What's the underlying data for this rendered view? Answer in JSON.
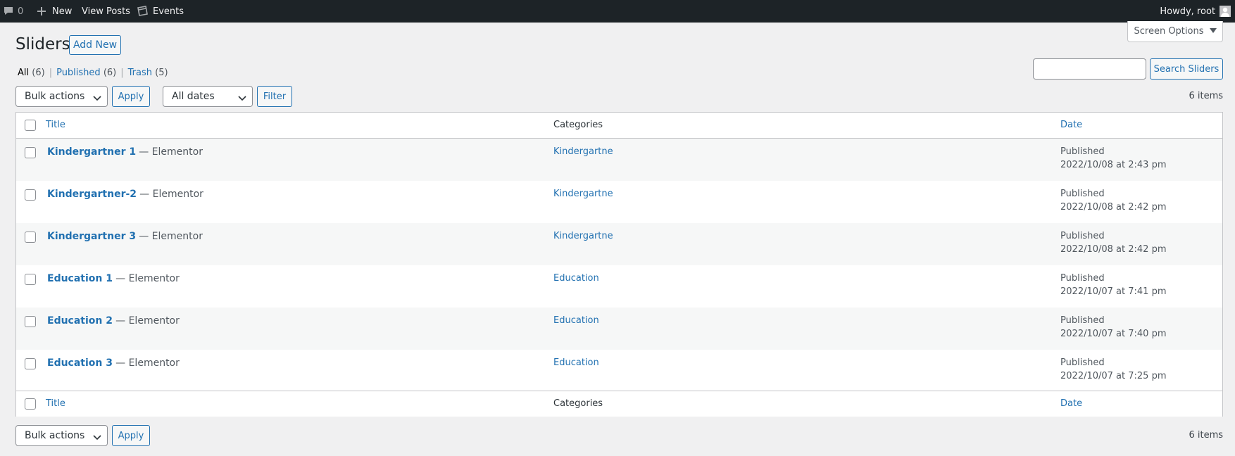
{
  "adminbar": {
    "comments_count": "0",
    "new_label": "New",
    "view_posts_label": "View Posts",
    "events_label": "Events",
    "howdy_label": "Howdy, root"
  },
  "screen_options": {
    "label": "Screen Options"
  },
  "page": {
    "title": "Sliders",
    "add_new_label": "Add New"
  },
  "views": [
    {
      "label": "All",
      "count": "(6)",
      "current": true
    },
    {
      "label": "Published",
      "count": "(6)",
      "current": false
    },
    {
      "label": "Trash",
      "count": "(5)",
      "current": false
    }
  ],
  "search": {
    "value": "",
    "button_label": "Search Sliders"
  },
  "tablenav_top": {
    "bulk_actions": "Bulk actions",
    "apply_label": "Apply",
    "dates_filter": "All dates",
    "filter_label": "Filter",
    "items_count": "6 items"
  },
  "tablenav_bottom": {
    "bulk_actions": "Bulk actions",
    "apply_label": "Apply",
    "items_count": "6 items"
  },
  "table": {
    "columns": {
      "title": "Title",
      "categories": "Categories",
      "date": "Date"
    },
    "rows": [
      {
        "title": "Kindergartner 1",
        "state": "— Elementor",
        "category": "Kindergartne",
        "status": "Published",
        "date": "2022/10/08 at 2:43 pm"
      },
      {
        "title": "Kindergartner-2",
        "state": "— Elementor",
        "category": "Kindergartne",
        "status": "Published",
        "date": "2022/10/08 at 2:42 pm"
      },
      {
        "title": "Kindergartner 3",
        "state": "— Elementor",
        "category": "Kindergartne",
        "status": "Published",
        "date": "2022/10/08 at 2:42 pm"
      },
      {
        "title": "Education 1",
        "state": "— Elementor",
        "category": "Education",
        "status": "Published",
        "date": "2022/10/07 at 7:41 pm"
      },
      {
        "title": "Education 2",
        "state": "— Elementor",
        "category": "Education",
        "status": "Published",
        "date": "2022/10/07 at 7:40 pm"
      },
      {
        "title": "Education 3",
        "state": "— Elementor",
        "category": "Education",
        "status": "Published",
        "date": "2022/10/07 at 7:25 pm"
      }
    ]
  }
}
